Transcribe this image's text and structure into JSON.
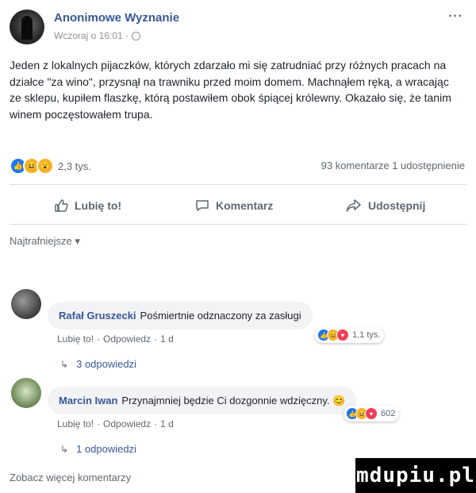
{
  "post": {
    "author": "Anonimowe Wyznanie",
    "timestamp": "Wczoraj o 16:01 ·",
    "privacy_icon": "globe-icon",
    "more_label": "···",
    "text": "Jeden z lokalnych pijaczków, których zdarzało mi się zatrudniać przy różnych pracach na działce \"za wino\", przysnął na trawniku przed moim domem. Machnąłem ręką, a wracając ze sklepu, kupiłem flaszkę, którą postawiłem obok śpiącej królewny. Okazało się, że tanim winem poczęstowałem trupa.",
    "reactions_count": "2,3 tys.",
    "stats": "93 komentarze  1 udostępnienie"
  },
  "actions": {
    "like": "Lubię to!",
    "comment": "Komentarz",
    "share": "Udostępnij"
  },
  "comments_filter": "Najtrafniejsze ▾",
  "comments": [
    {
      "name": "Rafał Gruszecki",
      "text": "Pośmiertnie odznaczony za zasługi",
      "like": "Lubię to!",
      "reply": "Odpowiedz",
      "age": "1 d",
      "reactions": "1,1 tys.",
      "replies": "3 odpowiedzi"
    },
    {
      "name": "Marcin Iwan",
      "text": "Przynajmniej będzie Ci dozgonnie wdzięczny. 😊",
      "like": "Lubię to!",
      "reply": "Odpowiedz",
      "age": "1 d",
      "reactions": "602",
      "replies": "1 odpowiedzi"
    }
  ],
  "more_comments": "Zobacz więcej komentarzy",
  "watermark": "mdupiu.pl",
  "colors": {
    "link": "#385898",
    "like_blue": "#1877f2",
    "muted": "#606770"
  }
}
